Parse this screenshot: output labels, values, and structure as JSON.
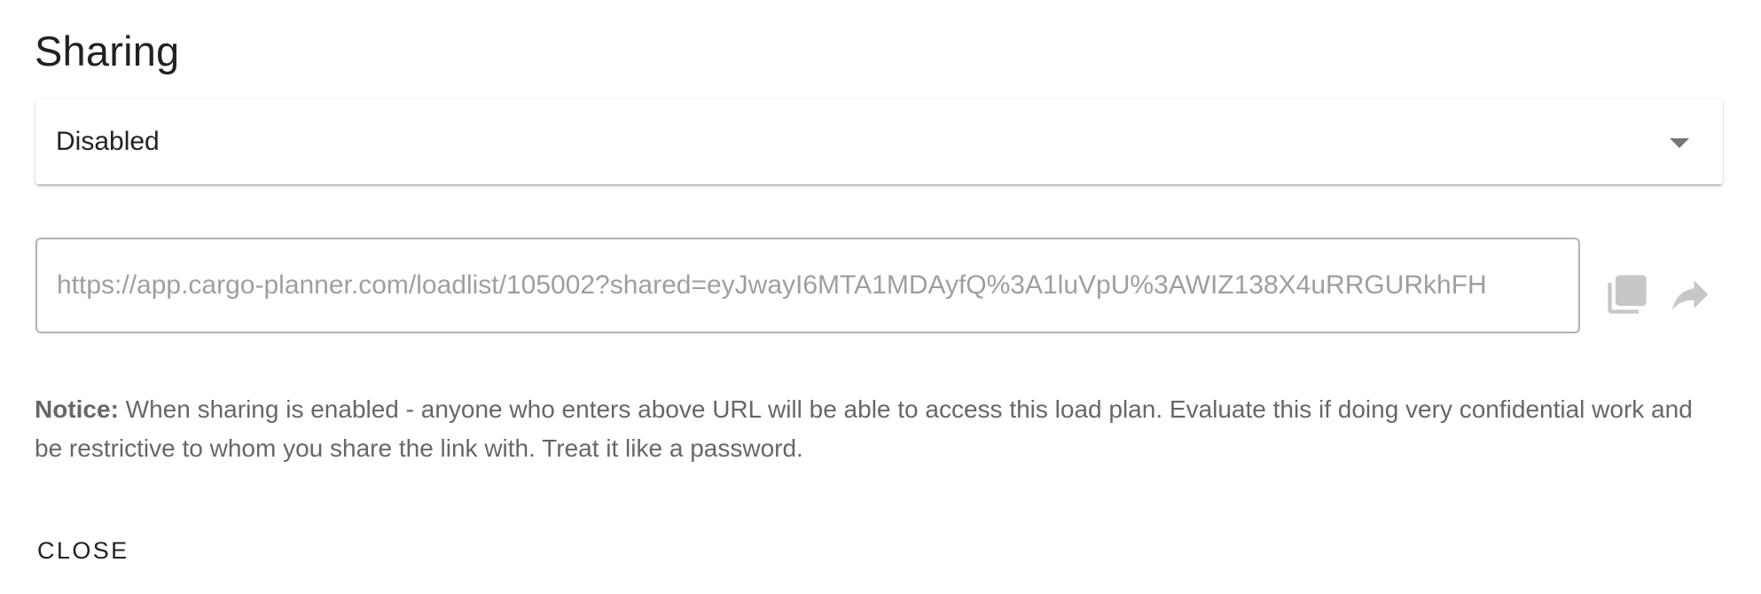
{
  "dialog": {
    "title": "Sharing",
    "sharing_select": {
      "selected": "Disabled"
    },
    "share_url": {
      "value": "https://app.cargo-planner.com/loadlist/105002?shared=eyJwayI6MTA1MDAyfQ%3A1luVpU%3AWIZ138X4uRRGURkhFH"
    },
    "icons": {
      "copy": "copy-icon",
      "share": "share-icon",
      "dropdown": "chevron-down-icon"
    },
    "notice": {
      "label": "Notice:",
      "text": " When sharing is enabled - anyone who enters above URL will be able to access this load plan. Evaluate this if doing very confidential work and be restrictive to whom you share the link with. Treat it like a password."
    },
    "close_label": "Close"
  },
  "colors": {
    "icon_disabled": "#c7c7c7",
    "placeholder_text": "#9e9e9e"
  }
}
